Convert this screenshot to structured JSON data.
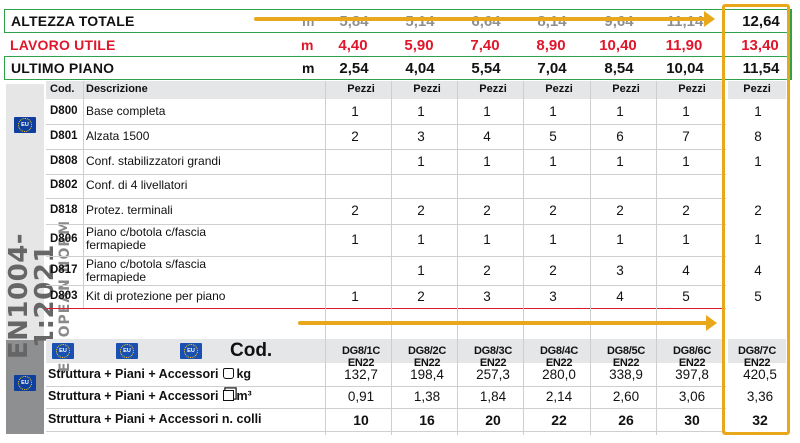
{
  "models": [
    "DG8/1C EN22",
    "DG8/2C EN22",
    "DG8/3C EN22",
    "DG8/4C EN22",
    "DG8/5C EN22",
    "DG8/6C EN22",
    "DG8/7C EN22"
  ],
  "heights": [
    {
      "label": "ALTEZZA TOTALE",
      "unit": "m",
      "values": [
        "5,84",
        "5,14",
        "6,64",
        "8,14",
        "9,64",
        "11,14",
        "12,64"
      ],
      "ghost": true
    },
    {
      "label": "LAVORO UTILE",
      "unit": "m",
      "values": [
        "4,40",
        "5,90",
        "7,40",
        "8,90",
        "10,40",
        "11,90",
        "13,40"
      ]
    },
    {
      "label": "ULTIMO PIANO",
      "unit": "m",
      "values": [
        "2,54",
        "4,04",
        "5,54",
        "7,04",
        "8,54",
        "10,04",
        "11,54"
      ]
    }
  ],
  "badge": {
    "line1": "EN1004-1:2021",
    "line2": "EUROPEAN NORM",
    "flag_text": "EU"
  },
  "parts_header": {
    "cod": "Cod.",
    "desc": "Descrizione",
    "qty": "Pezzi"
  },
  "parts": [
    {
      "code": "D800",
      "desc": "Base completa",
      "q": [
        "1",
        "1",
        "1",
        "1",
        "1",
        "1",
        "1"
      ]
    },
    {
      "code": "D801",
      "desc": "Alzata 1500",
      "q": [
        "2",
        "3",
        "4",
        "5",
        "6",
        "7",
        "8"
      ]
    },
    {
      "code": "D808",
      "desc": "Conf. stabilizzatori grandi",
      "q": [
        "",
        "1",
        "1",
        "1",
        "1",
        "1",
        "1"
      ]
    },
    {
      "code": "D802",
      "desc": "Conf. di 4 livellatori",
      "q": [
        "",
        "",
        "",
        "",
        "",
        "",
        ""
      ]
    },
    {
      "code": "D818",
      "desc": "Protez. terminali",
      "q": [
        "2",
        "2",
        "2",
        "2",
        "2",
        "2",
        "2"
      ]
    },
    {
      "code": "D806",
      "desc": "Piano c/botola c/fascia fermapiede",
      "q": [
        "1",
        "1",
        "1",
        "1",
        "1",
        "1",
        "1"
      ]
    },
    {
      "code": "D817",
      "desc": "Piano c/botola s/fascia fermapiede",
      "q": [
        "",
        "1",
        "2",
        "2",
        "3",
        "4",
        "4"
      ]
    },
    {
      "code": "D803",
      "desc": "Kit di protezione per piano",
      "q": [
        "1",
        "2",
        "3",
        "3",
        "4",
        "5",
        "5"
      ]
    }
  ],
  "bottom": {
    "cod_label": "Cod.",
    "rows": [
      {
        "label": "Struttura + Piani + Accessori",
        "suffix": "kg",
        "icon": "weight-icon",
        "values": [
          "132,7",
          "198,4",
          "257,3",
          "280,0",
          "338,9",
          "397,8",
          "420,5"
        ]
      },
      {
        "label": "Struttura + Piani + Accessori",
        "suffix": "m³",
        "icon": "volume-icon",
        "values": [
          "0,91",
          "1,38",
          "1,84",
          "2,14",
          "2,60",
          "3,06",
          "3,36"
        ]
      },
      {
        "label": "Struttura + Piani + Accessori",
        "suffix": "n. colli",
        "icon": "",
        "values": [
          "10",
          "16",
          "20",
          "22",
          "26",
          "30",
          "32"
        ]
      }
    ]
  },
  "colors": {
    "accent": "#e9a81b",
    "red": "#e0162b",
    "green": "#2ea24a",
    "eu_blue": "#0f3f9e"
  }
}
